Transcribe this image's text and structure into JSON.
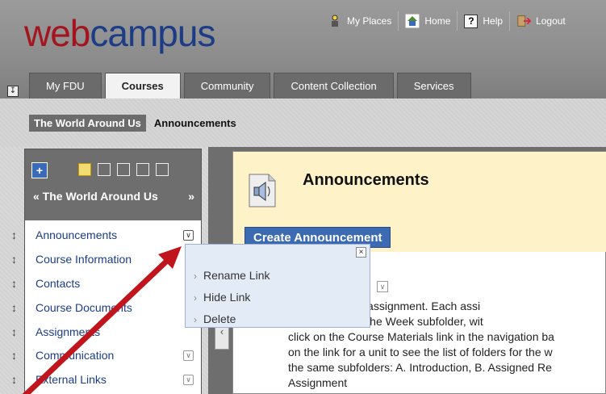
{
  "logo": {
    "part1": "web",
    "part2": "campus"
  },
  "util_links": [
    {
      "label": "My Places",
      "icon": "person-icon"
    },
    {
      "label": "Home",
      "icon": "home-icon"
    },
    {
      "label": "Help",
      "icon": "help-icon"
    },
    {
      "label": "Logout",
      "icon": "logout-icon"
    }
  ],
  "help_glyph": "?",
  "tabs": [
    "My FDU",
    "Courses",
    "Community",
    "Content Collection",
    "Services"
  ],
  "active_tab": "Courses",
  "breadcrumb": [
    "The World Around Us",
    "Announcements"
  ],
  "course_menu": {
    "title": "« The World Around Us",
    "collapse": "»",
    "add": "+",
    "items": [
      "Announcements",
      "Course Information",
      "Contacts",
      "Course Documents",
      "Assignments",
      "Communication",
      "External Links"
    ]
  },
  "context_menu": {
    "items": [
      "Rename Link",
      "Hide Link",
      "Delete"
    ],
    "close": "×"
  },
  "content": {
    "title": "Announcements",
    "create_button": "Create Announcement",
    "announcement_title": "s",
    "text_lines": [
      "l have a written assignment. Each assi",
      "ubfolder, within the Week subfolder, wit",
      "click on the Course Materials link in the navigation ba",
      "on the link for a unit to see the list of folders for the w",
      "the same subfolders: A. Introduction, B. Assigned Re",
      "Assignment"
    ]
  },
  "colors": {
    "logo_web": "#a3141f",
    "logo_campus": "#1c3c86",
    "link_blue": "#1c3c86",
    "button_blue": "#3d6bb3",
    "arrow_red": "#c0151c",
    "header_cream": "#fdf2c8"
  }
}
